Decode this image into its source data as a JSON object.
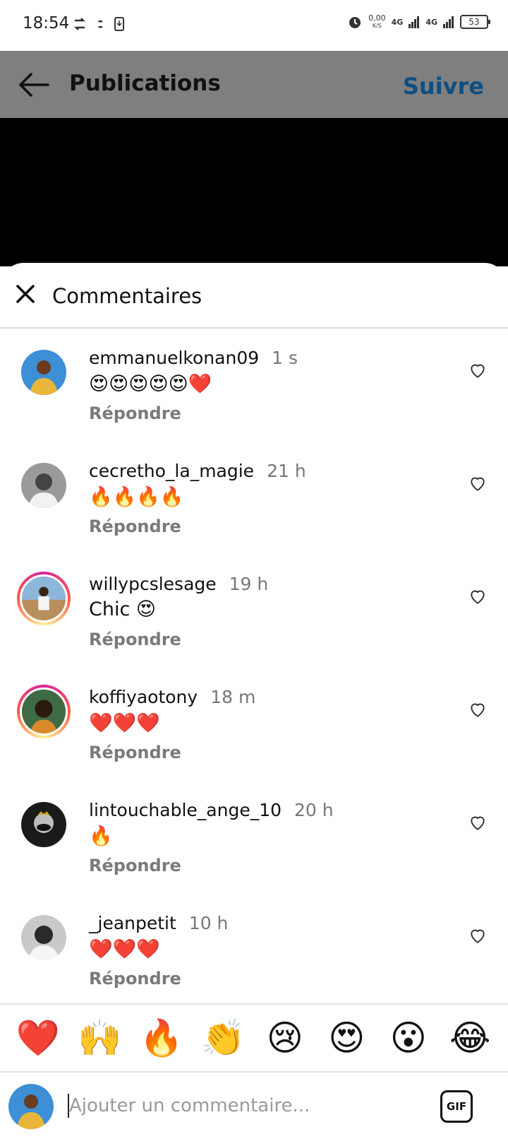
{
  "status_bar": {
    "time": "18:54",
    "speed_value": "0,00",
    "speed_unit": "K/S",
    "network_1": "4G",
    "network_2": "4G",
    "battery": "53",
    "icons": [
      "sync-icon",
      "news-icon",
      "download-icon",
      "alarm-icon",
      "signal-icon",
      "battery-icon"
    ]
  },
  "header": {
    "title": "Publications",
    "follow_label": "Suivre",
    "follow_color": "#0d4f82"
  },
  "sheet": {
    "title": "Commentaires",
    "reply_label": "Répondre"
  },
  "comments": [
    {
      "username": "emmanuelkonan09",
      "time": "1 s",
      "text": "😍😍😍😍😍❤️",
      "reply": "Répondre"
    },
    {
      "username": "cecretho_la_magie",
      "time": "21 h",
      "text": "🔥🔥🔥🔥",
      "reply": "Répondre"
    },
    {
      "username": "willypcslesage",
      "time": "19 h",
      "text": "Chic 😍",
      "reply": "Répondre"
    },
    {
      "username": "koffiyaotony",
      "time": "18 m",
      "text": "❤️❤️❤️",
      "reply": "Répondre"
    },
    {
      "username": "lintouchable_ange_10",
      "time": "20 h",
      "text": "🔥",
      "reply": "Répondre"
    },
    {
      "username": "_jeanpetit",
      "time": "10 h",
      "text": "❤️❤️❤️",
      "reply": "Répondre"
    }
  ],
  "reactions": [
    "❤️",
    "🙌",
    "🔥",
    "👏",
    "😢",
    "😍",
    "😮",
    "😂"
  ],
  "composer": {
    "placeholder": "Ajouter un commentaire...",
    "gif_label": "GIF"
  }
}
